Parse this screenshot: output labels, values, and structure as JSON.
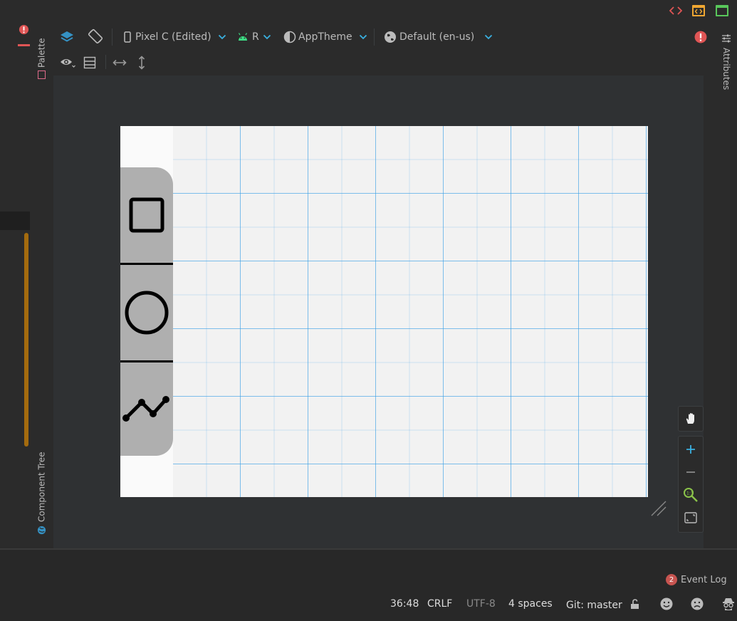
{
  "toolbar": {
    "device_label": "Pixel C (Edited)",
    "api_label": "R",
    "theme_label": "AppTheme",
    "locale_label": "Default (en-us)"
  },
  "side_tabs": {
    "palette": "Palette",
    "component_tree": "Component Tree",
    "attributes": "Attributes"
  },
  "drawing_tools": [
    "rectangle-tool",
    "circle-tool",
    "polyline-tool"
  ],
  "event_log": {
    "count": "2",
    "label": "Event Log"
  },
  "status": {
    "cursor": "36:48",
    "line_separator": "CRLF",
    "encoding": "UTF-8",
    "indent": "4 spaces",
    "git": "Git: master"
  },
  "colors": {
    "accent_blue": "#3592c4",
    "error_red": "#e05555",
    "android_green": "#3ddc84",
    "scroll_orange": "#a46b0e"
  }
}
